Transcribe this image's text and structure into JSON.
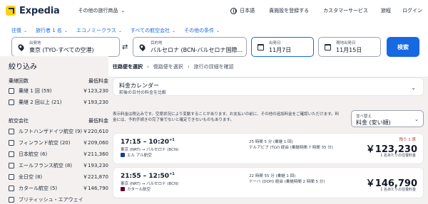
{
  "header": {
    "logo_text": "Expedia",
    "other_products": "その他の旅行商品",
    "language": "日本語",
    "list_property": "貴施設を登録する",
    "support": "カスタマーサービス",
    "trips": "旅程",
    "login": "ログイン"
  },
  "chips": [
    "往復",
    "旅行者 1 名",
    "エコノミークラス",
    "すべての航空会社",
    "その他の条件"
  ],
  "search": {
    "from_label": "出発地",
    "from_value": "東京 (TYO-すべての空港)",
    "to_label": "目的地",
    "to_value": "バルセロナ (BCN-バルセロナ国際...",
    "depart_label": "出発日",
    "depart_value": "11月7日",
    "return_label": "現地出発日",
    "return_value": "11月15日",
    "button": "検索"
  },
  "sidebar": {
    "title": "絞り込み",
    "stops_heading": "乗継回数",
    "price_heading": "最低料金",
    "stops": [
      {
        "label": "乗継 1 回 (59)",
        "price": "￥123,230"
      },
      {
        "label": "乗継 2 回以上 (21)",
        "price": "￥193,230"
      }
    ],
    "airlines_heading": "航空会社",
    "airlines_price_heading": "最低料金",
    "airlines": [
      {
        "label": "ルフトハンザドイツ航空 (9)",
        "price": "￥220,610"
      },
      {
        "label": "フィンランド航空 (20)",
        "price": "￥209,060"
      },
      {
        "label": "日本航空 (6)",
        "price": "￥211,360"
      },
      {
        "label": "エールフランス航空 (8)",
        "price": "￥193,230"
      },
      {
        "label": "全日空 (8)",
        "price": "￥221,870"
      },
      {
        "label": "カタール航空 (5)",
        "price": "￥146,790"
      },
      {
        "label": "ブリティッシュ・エアウェイ",
        "price": ""
      }
    ]
  },
  "main": {
    "crumbs": [
      "往路便を選択",
      "復路便を選択",
      "旅行の詳細を確認"
    ],
    "calendar_title": "料金カレンダー",
    "calendar_sub": "前後の日付の料金を比較",
    "notice": "表示料金は税込みです。空席状況により変動することがあります。お支払いの前に、その他の追加料金をご確認いただけます。料金には、予約手続きの完了後でないと確定できないものもあります。",
    "sort_label": "並べ替え",
    "sort_value": "料金 (安い順)"
  },
  "flights": [
    {
      "time": "17:15 – 10:20",
      "day_offset": "+1",
      "route": "東京 (NRT) → バルセロナ (BCN)",
      "airline": "エル アル航空",
      "duration": "25 時間 5 分 (乗継 1 回)",
      "via": "テルアビブ (TLV) 経由 (乗継時間 7 時間 35 分)",
      "seats_left": "残り 1 席",
      "price": "￥123,230",
      "per_person": "1 名あたりの往復料金"
    },
    {
      "time": "21:55 – 12:50",
      "day_offset": "+1",
      "route": "東京 (NRT) → バルセロナ (BCN)",
      "airline": "カタール航空",
      "duration": "22 時間 55 分 (乗継 1 回)",
      "via": "ドーハ (DOH) 経由 (乗継時間 2 時間 5 分)",
      "seats_left": "",
      "price": "￥146,790",
      "per_person": "1 名あたりの往復料金"
    }
  ],
  "colors": {
    "accent": "#1668e3",
    "logo_yellow": "#fcd116",
    "alert": "#c0392b"
  }
}
